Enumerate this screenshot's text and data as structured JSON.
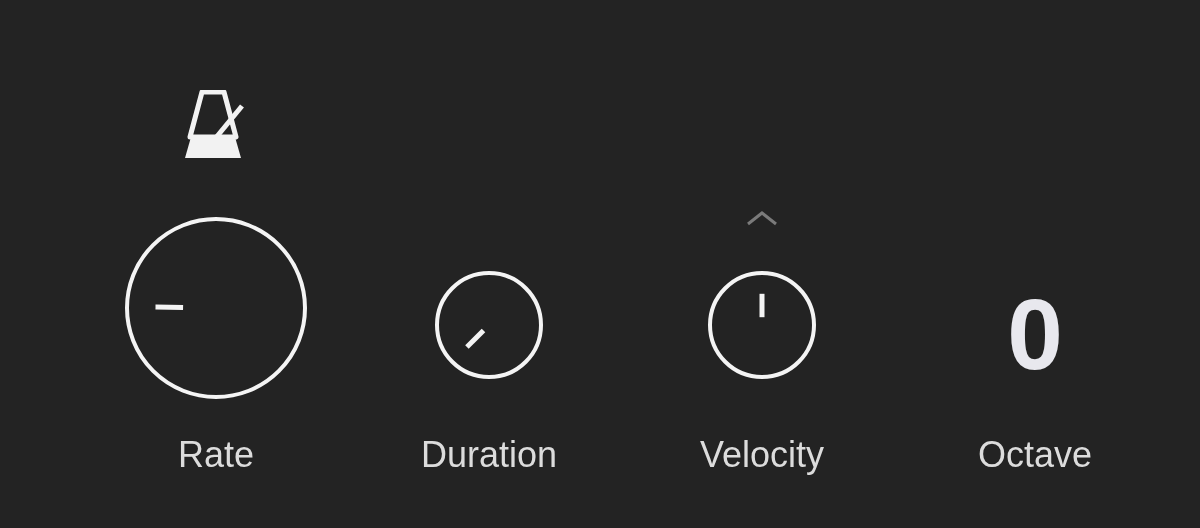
{
  "controls": [
    {
      "kind": "large-knob",
      "label": "Rate"
    },
    {
      "kind": "knob",
      "label": "Duration"
    },
    {
      "kind": "knob",
      "label": "Velocity"
    },
    {
      "kind": "value",
      "label": "Octave",
      "value": "0"
    }
  ]
}
